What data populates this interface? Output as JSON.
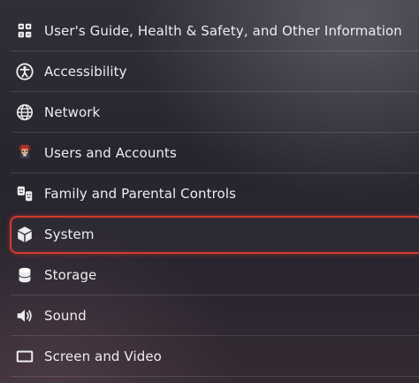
{
  "settings_menu": {
    "items": [
      {
        "label": "User's Guide, Health & Safety, and Other Information",
        "icon": "info-tiles-icon"
      },
      {
        "label": "Accessibility",
        "icon": "accessibility-icon"
      },
      {
        "label": "Network",
        "icon": "globe-icon"
      },
      {
        "label": "Users and Accounts",
        "icon": "user-avatar-icon"
      },
      {
        "label": "Family and Parental Controls",
        "icon": "family-icon"
      },
      {
        "label": "System",
        "icon": "cube-icon",
        "selected": true
      },
      {
        "label": "Storage",
        "icon": "database-icon"
      },
      {
        "label": "Sound",
        "icon": "speaker-icon"
      },
      {
        "label": "Screen and Video",
        "icon": "screen-icon"
      }
    ]
  },
  "colors": {
    "focus_ring": "#d23a2f",
    "text": "#ededf0"
  }
}
